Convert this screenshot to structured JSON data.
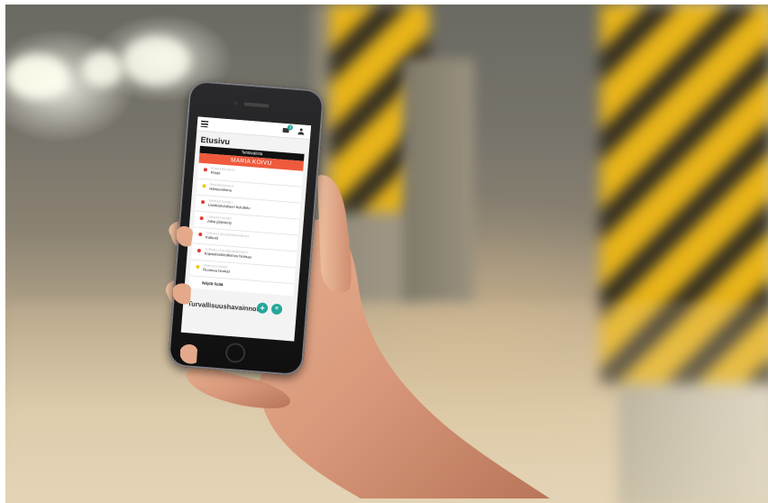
{
  "app": {
    "page_title": "Etusivu",
    "badge_count": "3",
    "task_card": {
      "header": "Tehtävälista",
      "assignee": "MARIA KOIVU",
      "items": [
        {
          "category": "Riskiarviointi",
          "title": "Pöstö",
          "status_color": "#e53935"
        },
        {
          "category": "Riskiarviointi",
          "title": "Hämeenlinna",
          "status_color": "#f5c518"
        },
        {
          "category": "Tarkastukset",
          "title": "Lisäkoulutuksen kuluttelu",
          "status_color": "#e53935"
        },
        {
          "category": "Tarkastukset",
          "title": "Jokia järjestely",
          "status_color": "#e53935"
        },
        {
          "category": "Turvallisuusehavainnot",
          "title": "Kaltevä",
          "status_color": "#e53935"
        },
        {
          "category": "Turvallisuusehavainnot",
          "title": "Kapasiteettitutkimus hiomaa",
          "status_color": "#e53935"
        },
        {
          "category": "Tarkastukset",
          "title": "Ruumaa hiomät",
          "status_color": "#f5c518"
        }
      ],
      "show_more": "Näytä lisää"
    },
    "observations": {
      "title": "Turvallisuushavainnot",
      "add_icon": "+",
      "menu_icon": "≡"
    }
  },
  "colors": {
    "accent": "#26a69a",
    "header_red": "#ef5a3c",
    "warning_yellow": "#e8b419"
  }
}
